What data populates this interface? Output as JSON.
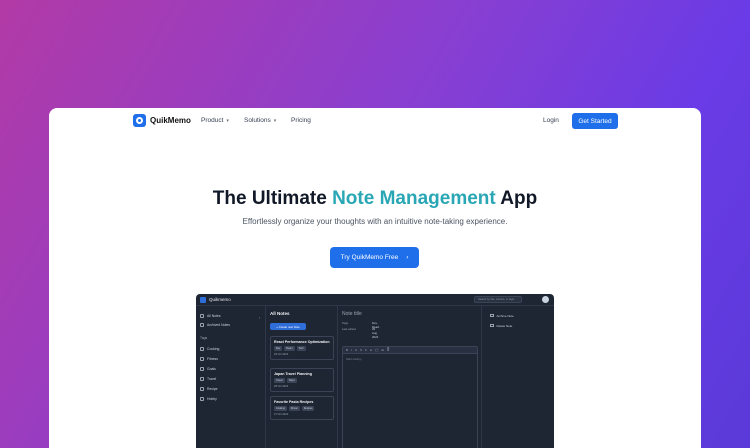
{
  "nav": {
    "brand": "QuikMemo",
    "links": [
      "Product",
      "Solutions",
      "Pricing"
    ],
    "login": "Login",
    "cta": "Get Started"
  },
  "hero": {
    "title_pre": "The Ultimate ",
    "title_accent": "Note Management",
    "title_post": " App",
    "subtitle": "Effortlessly organize your thoughts with an intuitive note-taking experience.",
    "cta": "Try QuikMemo Free"
  },
  "colors": {
    "accent": "#2aa7b5",
    "primary": "#1f6feb"
  },
  "preview": {
    "brand": "Quikmemo",
    "search_placeholder": "Search by title, content, or tags...",
    "sidebar": {
      "all_notes": "All Notes",
      "archived": "Archived Notes",
      "tags_heading": "Tags",
      "tags": [
        "Cooking",
        "Fitness",
        "Goals",
        "Travel",
        "Recipe",
        "Hobby"
      ]
    },
    "list": {
      "title": "All Notes",
      "create": "+ Create new Note",
      "notes": [
        {
          "title": "React Performance Optimization",
          "tags": [
            "Dev",
            "React",
            "Tech"
          ],
          "date": "29 Oct 2024"
        },
        {
          "title": "Japan Travel Planning",
          "tags": [
            "Travel",
            "Tokyo"
          ],
          "date": "28 Oct 2024"
        },
        {
          "title": "Favorite Pasta Recipes",
          "tags": [
            "Cooking",
            "Dinner",
            "Recipes"
          ],
          "date": "27 Oct 2024"
        }
      ]
    },
    "editor": {
      "title": "Note title",
      "tags_label": "Tags",
      "tags_value": "Dev, React",
      "edited_label": "Last edited",
      "edited_value": "29 Aug 2024",
      "toolbar": [
        "B",
        "I",
        "U",
        "S",
        "≡",
        "H",
        "◯",
        "⊞",
        "≣"
      ],
      "placeholder": "Start writing..."
    },
    "actions": [
      "Archive Note",
      "Delete Note"
    ]
  }
}
